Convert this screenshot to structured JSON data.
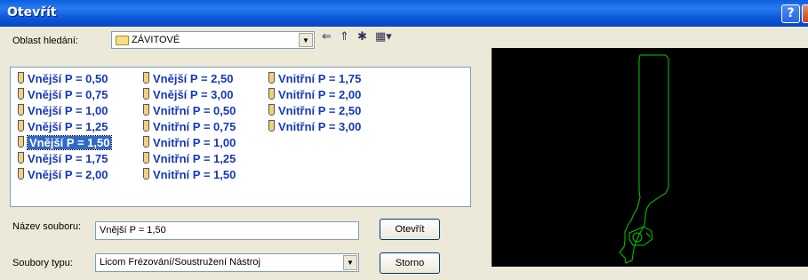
{
  "window": {
    "title": "Otevřít"
  },
  "titlebar_buttons": {
    "help": "?"
  },
  "lookin": {
    "label": "Oblast hledání:",
    "value": "ZÁVITOVÉ"
  },
  "toolbar": {
    "back_icon": "back-arrow-icon",
    "up_icon": "up-folder-icon",
    "new_icon": "new-folder-icon",
    "view_icon": "view-menu-icon",
    "back_glyph": "⇐",
    "up_glyph": "⇑",
    "new_glyph": "✱",
    "view_glyph": "▦▾"
  },
  "files": [
    "Vnější P = 0,50",
    "Vnější P = 0,75",
    "Vnější P = 1,00",
    "Vnější P = 1,25",
    "Vnější P = 1,50",
    "Vnější P = 1,75",
    "Vnější P = 2,00",
    "Vnější P = 2,50",
    "Vnější P = 3,00",
    "Vnitřní P = 0,50",
    "Vnitřní P = 0,75",
    "Vnitřní P = 1,00",
    "Vnitřní P = 1,25",
    "Vnitřní P = 1,50",
    "Vnitřní P = 1,75",
    "Vnitřní P = 2,00",
    "Vnitřní P = 2,50",
    "Vnitřní P = 3,00"
  ],
  "selected_file": "Vnější P = 1,50",
  "filename": {
    "label": "Název souboru:",
    "value": "Vnější P = 1,50"
  },
  "filetype": {
    "label": "Soubory typu:",
    "value": "Licom Frézování/Soustružení Nástroj"
  },
  "buttons": {
    "open": "Otevřít",
    "cancel": "Storno"
  },
  "colors": {
    "file_text": "#1538b8",
    "selection": "#316ac5",
    "preview_bg": "#000000",
    "preview_line": "#00cc00"
  }
}
